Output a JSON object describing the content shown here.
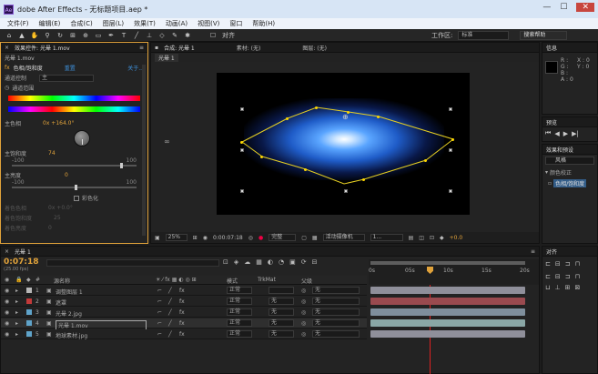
{
  "window": {
    "title": "dobe After Effects - 无标题项目.aep *"
  },
  "menu": [
    "文件(F)",
    "编辑(E)",
    "合成(C)",
    "图层(L)",
    "效果(T)",
    "动画(A)",
    "视图(V)",
    "窗口",
    "帮助(H)"
  ],
  "toolbar": {
    "snap_label": "对齐",
    "workspace_label": "工作区:",
    "workspace_value": "标准",
    "search_placeholder": "搜索帮助"
  },
  "effect_controls": {
    "tab_label": "效果控件: 光晕 1.mov",
    "layer_name": "光晕 1.mov",
    "effect_name": "色相/饱和度",
    "reset_label": "重置",
    "about_label": "关于...",
    "channel_control_label": "通道控制",
    "channel_control_value": "主",
    "channel_range_label": "通道范围",
    "hue_label": "主色相",
    "hue_value": "0x +164.0°",
    "saturation_label": "主饱和度",
    "saturation_value": "74",
    "saturation_min": "-100",
    "saturation_max": "100",
    "lightness_label": "主亮度",
    "lightness_value": "0",
    "lightness_min": "-100",
    "lightness_max": "100",
    "colorize_label": "彩色化",
    "colorize_hue_label": "着色色相",
    "colorize_hue_value": "0x +0.0°",
    "colorize_sat_label": "着色饱和度",
    "colorize_sat_value": "25",
    "colorize_light_label": "着色亮度",
    "colorize_light_value": "0"
  },
  "composition": {
    "tab_label": "合成: 光晕 1",
    "footage_label": "素材: (无)",
    "layer_label": "图层: (无)",
    "flow_tab": "光晕 1",
    "zoom": "25%",
    "timecode": "0:00:07:18",
    "quality": "完整",
    "camera": "活动摄像机",
    "views": "1...",
    "exposure": "+0.0"
  },
  "info_panel": {
    "tab": "信息",
    "r_label": "R :",
    "g_label": "G :",
    "b_label": "B :",
    "a_label": "A : 0",
    "x_label": "X : 0",
    "y_label": "Y : 0"
  },
  "preview_panel": {
    "tab": "预览"
  },
  "effects_presets": {
    "tab": "效果和预设",
    "search_value": "风格",
    "category": "颜色校正",
    "item": "色相/饱和度"
  },
  "timeline": {
    "tab": "光晕 1",
    "timecode": "0:07:18",
    "fps": "(25.00 fps)",
    "columns": {
      "source_name": "源名称",
      "mode": "模式",
      "trkmat": "TrkMat",
      "parent": "父级"
    },
    "ruler_labels": [
      "0s",
      "05s",
      "10s",
      "15s",
      "20s"
    ],
    "layers": [
      {
        "num": "1",
        "name": "调整图层 1",
        "mode": "正常",
        "trkmat": "",
        "parent": "无",
        "color": "#b7b7b7",
        "bar_color": "#8f8f9a"
      },
      {
        "num": "2",
        "name": "遮罩",
        "mode": "正常",
        "trkmat": "无",
        "parent": "无",
        "color": "#c23a3a",
        "bar_color": "#9a4a4f"
      },
      {
        "num": "3",
        "name": "光晕 2.jpg",
        "mode": "正常",
        "trkmat": "无",
        "parent": "无",
        "color": "#5fa3c9",
        "bar_color": "#7f8f9d"
      },
      {
        "num": "4",
        "name": "光晕 1.mov",
        "mode": "正常",
        "trkmat": "无",
        "parent": "无",
        "color": "#5fa3c9",
        "bar_color": "#8aa7a6"
      },
      {
        "num": "5",
        "name": "地球素材.jpg",
        "mode": "正常",
        "trkmat": "无",
        "parent": "无",
        "color": "#5fa3c9",
        "bar_color": "#8f8f9a"
      }
    ]
  },
  "align_panel": {
    "tab": "对齐"
  },
  "colors": {
    "accent": "#3d8fd8",
    "highlight": "#e0a23a",
    "mask_path": "#ffd800"
  }
}
